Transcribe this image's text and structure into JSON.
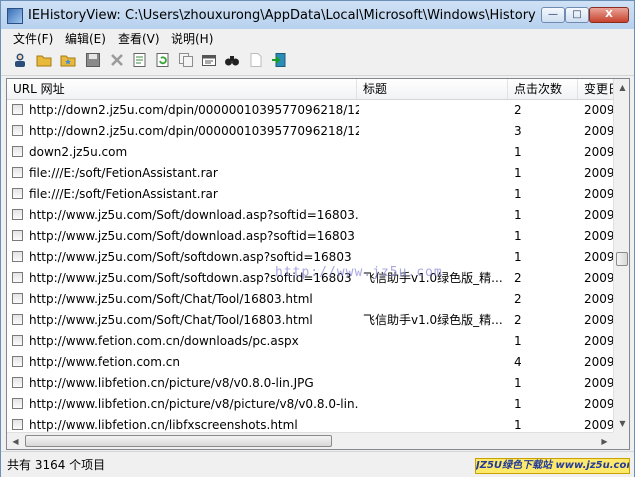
{
  "window": {
    "title": "IEHistoryView:  C:\\Users\\zhouxurong\\AppData\\Local\\Microsoft\\Windows\\History",
    "min_glyph": "—",
    "max_glyph": "□",
    "close_glyph": "X"
  },
  "menu": [
    "文件(F)",
    "编辑(E)",
    "查看(V)",
    "说明(H)"
  ],
  "toolbar": [
    {
      "icon": "user-icon",
      "color": "#2b4d7a"
    },
    {
      "icon": "folder-icon",
      "color": "#e8b93a"
    },
    {
      "icon": "favorites-folder-icon",
      "color": "#e8b93a"
    },
    {
      "icon": "save-icon",
      "color": "#8a8a8a"
    },
    {
      "icon": "delete-icon",
      "color": "#9a9a9a"
    },
    {
      "icon": "properties-icon",
      "color": "#3c8a3c"
    },
    {
      "icon": "refresh-icon",
      "color": "#3aa33a"
    },
    {
      "icon": "copy-icon",
      "color": "#8d8d8d"
    },
    {
      "icon": "html-report-icon",
      "color": "#555555"
    },
    {
      "icon": "find-icon",
      "color": "#222222"
    },
    {
      "icon": "blank-page-icon",
      "color": "#bdbdbd"
    },
    {
      "icon": "exit-icon",
      "color": "#2a8db8"
    }
  ],
  "columns": [
    "URL 网址",
    "标题",
    "点击次数",
    "变更日"
  ],
  "rows": [
    {
      "url": "http://down2.jz5u.com/dpin/0000001039577096218/12...",
      "title": "",
      "hits": "2",
      "date": "2009,"
    },
    {
      "url": "http://down2.jz5u.com/dpin/0000001039577096218/12...",
      "title": "",
      "hits": "3",
      "date": "2009,"
    },
    {
      "url": "down2.jz5u.com",
      "title": "",
      "hits": "1",
      "date": "2009,"
    },
    {
      "url": "file:///E:/soft/FetionAssistant.rar",
      "title": "",
      "hits": "1",
      "date": "2009,"
    },
    {
      "url": "file:///E:/soft/FetionAssistant.rar",
      "title": "",
      "hits": "1",
      "date": "2009,"
    },
    {
      "url": "http://www.jz5u.com/Soft/download.asp?softid=16803...",
      "title": "",
      "hits": "1",
      "date": "2009,"
    },
    {
      "url": "http://www.jz5u.com/Soft/download.asp?softid=16803",
      "title": "",
      "hits": "1",
      "date": "2009,"
    },
    {
      "url": "http://www.jz5u.com/Soft/softdown.asp?softid=16803",
      "title": "",
      "hits": "1",
      "date": "2009,"
    },
    {
      "url": "http://www.jz5u.com/Soft/softdown.asp?softid=16803",
      "title": "飞信助手v1.0绿色版_精...",
      "hits": "2",
      "date": "2009,"
    },
    {
      "url": "http://www.jz5u.com/Soft/Chat/Tool/16803.html",
      "title": "",
      "hits": "2",
      "date": "2009,"
    },
    {
      "url": "http://www.jz5u.com/Soft/Chat/Tool/16803.html",
      "title": "飞信助手v1.0绿色版_精...",
      "hits": "2",
      "date": "2009,"
    },
    {
      "url": "http://www.fetion.com.cn/downloads/pc.aspx",
      "title": "",
      "hits": "1",
      "date": "2009,"
    },
    {
      "url": "http://www.fetion.com.cn",
      "title": "",
      "hits": "4",
      "date": "2009,"
    },
    {
      "url": "http://www.libfetion.cn/picture/v8/v0.8.0-lin.JPG",
      "title": "",
      "hits": "1",
      "date": "2009,"
    },
    {
      "url": "http://www.libfetion.cn/picture/v8/picture/v8/v0.8.0-lin...",
      "title": "",
      "hits": "1",
      "date": "2009,"
    },
    {
      "url": "http://www.libfetion.cn/libfxscreenshots.html",
      "title": "",
      "hits": "1",
      "date": "2009,"
    }
  ],
  "watermark": "http://www.jz5u.com",
  "status": {
    "count_text": "共有 3164 个项目",
    "badge": "JZ5U绿色下载站 www.jz5u.com"
  }
}
